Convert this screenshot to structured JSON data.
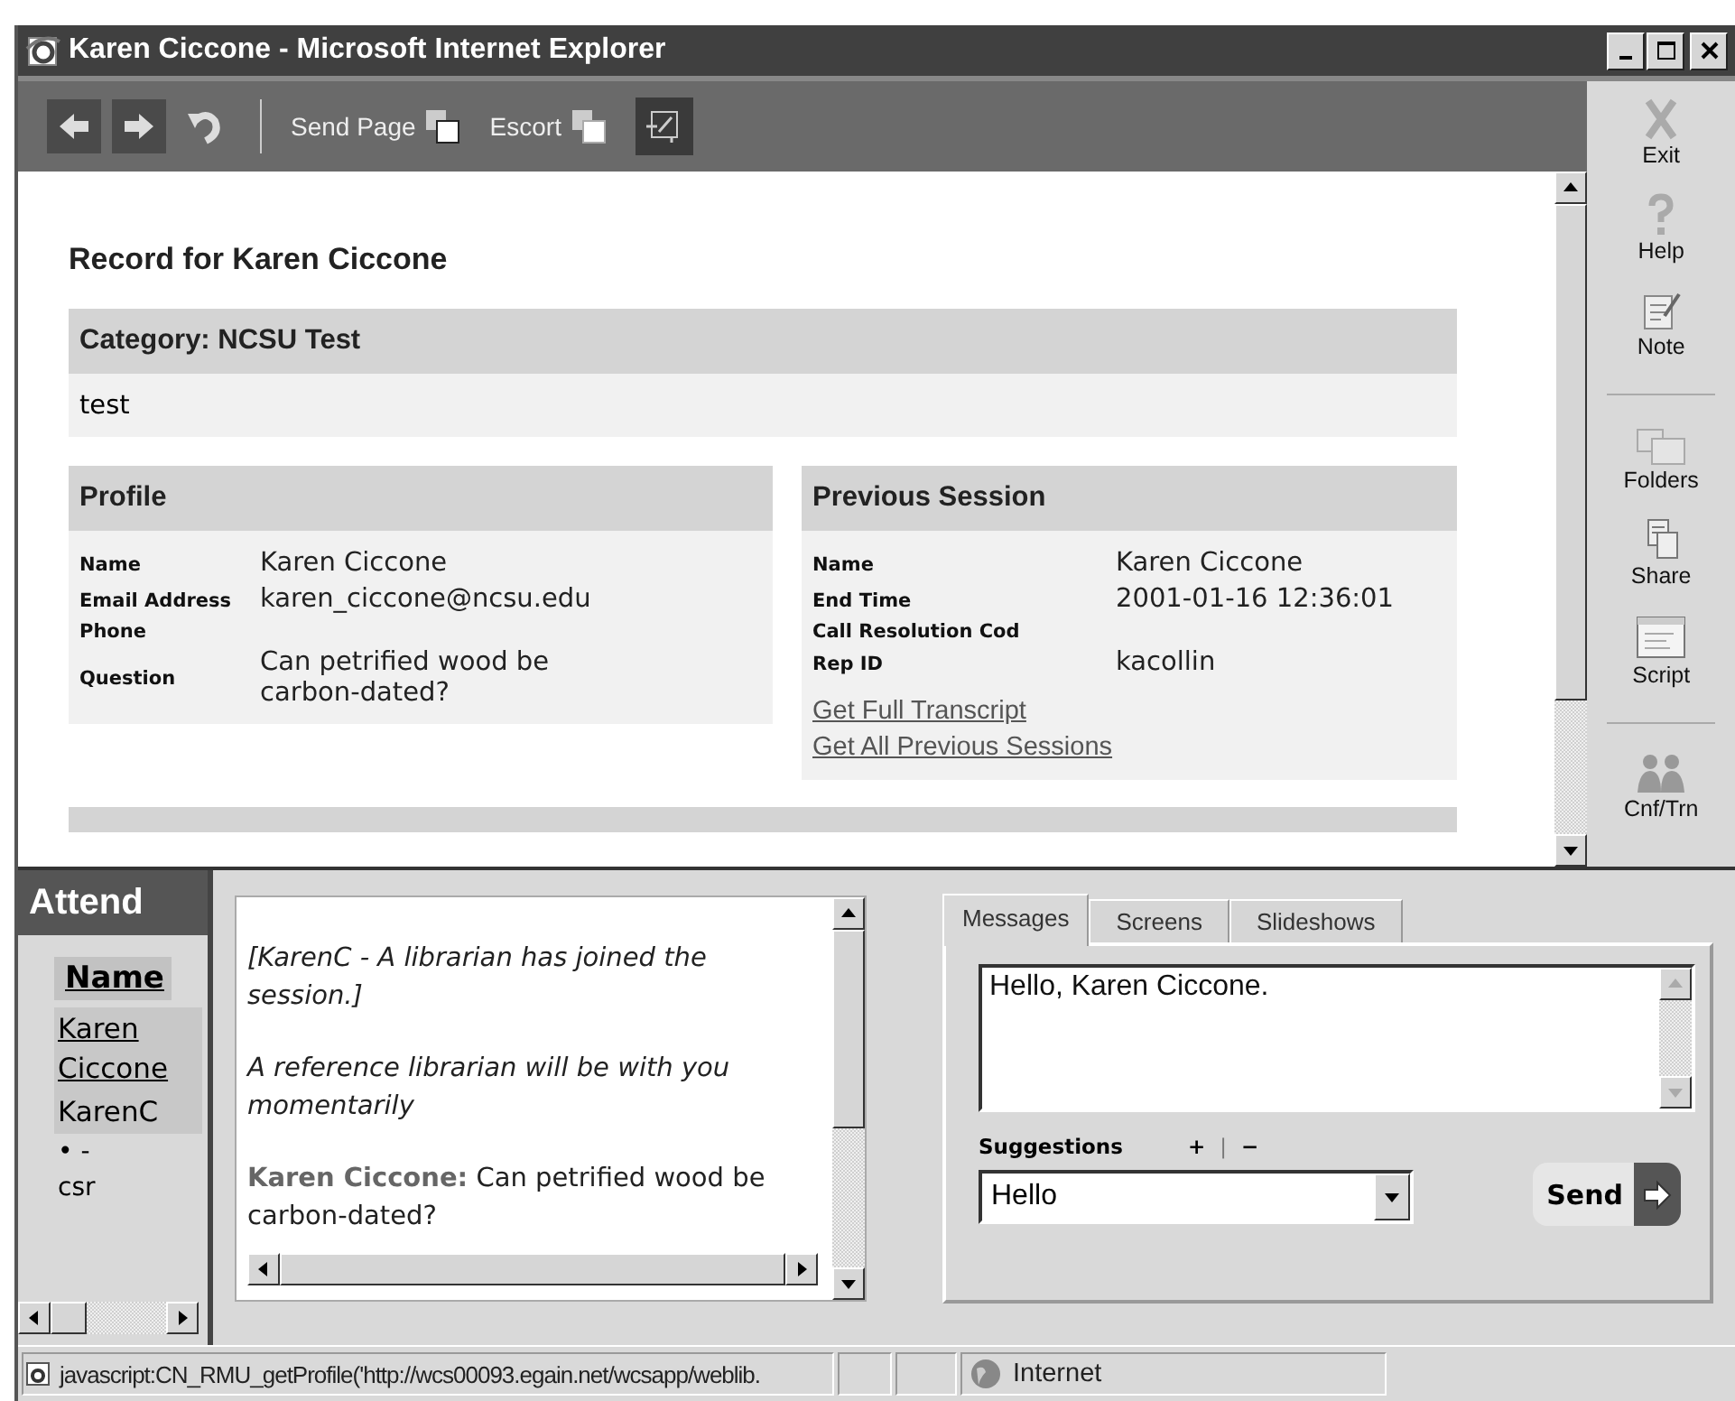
{
  "window": {
    "title": "Karen Ciccone - Microsoft Internet Explorer"
  },
  "toolbar": {
    "items": [
      {
        "kind": "back"
      },
      {
        "kind": "forward"
      },
      {
        "kind": "refresh"
      },
      {
        "kind": "separator"
      },
      {
        "kind": "send",
        "label": "Send Page"
      },
      {
        "kind": "escort",
        "label": "Escort"
      },
      {
        "kind": "frame"
      }
    ]
  },
  "record": {
    "heading": "Record for Karen Ciccone"
  },
  "category": {
    "label": "Category: NCSU Test",
    "text": "test"
  },
  "profile": {
    "title": "Profile",
    "fields": [
      {
        "label": "Name",
        "value": "Karen Ciccone"
      },
      {
        "label": "Email Address",
        "value": "karen_ciccone@ncsu.edu"
      },
      {
        "label": "Phone"
      },
      {
        "label": "Question",
        "value": "Can petrified wood be carbon-dated?"
      }
    ]
  },
  "previous_session": {
    "title": "Previous Session",
    "fields": [
      {
        "label": "Name",
        "value": "Karen Ciccone"
      },
      {
        "label": "End Time",
        "value": "2001-01-16 12:36:01"
      },
      {
        "label": "Call Resolution Cod"
      },
      {
        "label": "Rep ID",
        "value": "kacollin"
      }
    ],
    "links": [
      "Get Full Transcript",
      "Get All Previous Sessions"
    ]
  },
  "sidebar": {
    "items": [
      {
        "kind": "exit",
        "label": "Exit"
      },
      {
        "kind": "help",
        "label": "Help"
      },
      {
        "kind": "note",
        "label": "Note"
      },
      {
        "kind": "divider"
      },
      {
        "kind": "folders",
        "label": "Folders"
      },
      {
        "kind": "share",
        "label": "Share"
      },
      {
        "kind": "script",
        "label": "Script"
      },
      {
        "kind": "divider"
      },
      {
        "kind": "conference",
        "label": "Cnf/Trn"
      }
    ]
  },
  "attendees": {
    "title": "Attend",
    "column": "Name",
    "rows": [
      {
        "name": "Karen Ciccone",
        "link": true
      },
      {
        "name": "KarenC",
        "link": false
      }
    ],
    "status": "• -",
    "role": "csr"
  },
  "chat": {
    "messages": [
      {
        "kind": "system",
        "text": "[KarenC - A librarian has joined the session.]"
      },
      {
        "kind": "system",
        "text": "A reference librarian will be with you momentarily"
      },
      {
        "kind": "user",
        "sender": "Karen Ciccone:",
        "text": "Can petrified wood be carbon-dated?"
      }
    ]
  },
  "tabs": [
    {
      "label": "Messages",
      "selected": true
    },
    {
      "label": "Screens",
      "selected": false
    },
    {
      "label": "Slideshows",
      "selected": false
    }
  ],
  "message": {
    "value": "Hello, Karen Ciccone."
  },
  "suggestions": {
    "label": "Suggestions",
    "add": "+",
    "separator": "|",
    "remove": "−",
    "value": "Hello"
  },
  "send_button": {
    "label": "Send"
  },
  "status_bar": {
    "text": "javascript:CN_RMU_getProfile('http://wcs00093.egain.net/wcsapp/weblib.",
    "zone": "Internet"
  }
}
